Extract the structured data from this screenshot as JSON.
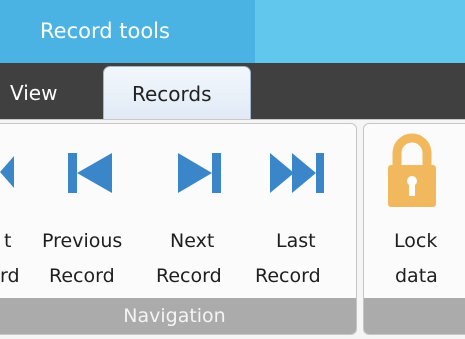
{
  "ribbon": {
    "context_tab_label": "Record tools",
    "tabs": [
      {
        "label": "View",
        "active": false
      },
      {
        "label": "Records",
        "active": true
      }
    ],
    "groups": {
      "navigation": {
        "label": "Navigation",
        "buttons": [
          {
            "line1": "t",
            "line2": "rd",
            "icon": "first-record-icon"
          },
          {
            "line1": "Previous",
            "line2": "Record",
            "icon": "previous-record-icon"
          },
          {
            "line1": "Next",
            "line2": "Record",
            "icon": "next-record-icon"
          },
          {
            "line1": "Last",
            "line2": "Record",
            "icon": "last-record-icon"
          }
        ]
      },
      "lock": {
        "buttons": [
          {
            "line1": "Lock",
            "line2": "data",
            "icon": "padlock-icon"
          }
        ]
      }
    },
    "colors": {
      "context_bar": "#61c7ec",
      "context_tab": "#4ab3e4",
      "nav_icon": "#3a86c8",
      "lock_icon": "#f2b85d"
    }
  }
}
